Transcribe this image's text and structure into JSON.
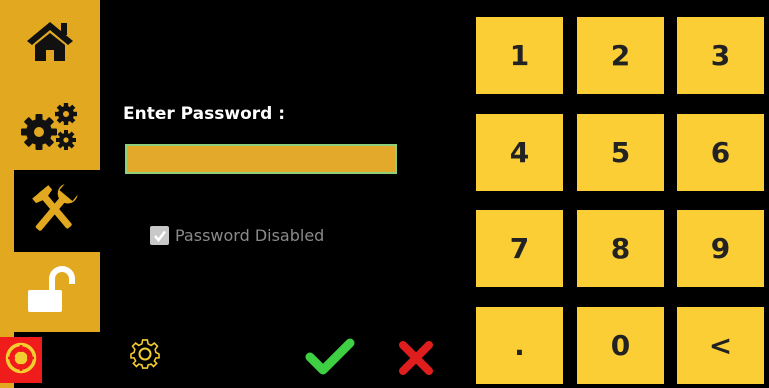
{
  "colors": {
    "accent": "#e2a81f",
    "key_bg": "#fcce35",
    "background": "#000000",
    "input_border": "#8ed07a",
    "ok_green": "#3ecf42",
    "cancel_red": "#e01d1d",
    "alarm_red": "#f01c1c"
  },
  "sidebar": {
    "items": [
      {
        "icon": "home-icon"
      },
      {
        "icon": "gears-icon"
      },
      {
        "icon": "tools-icon"
      },
      {
        "icon": "unlock-icon"
      },
      {
        "icon": "alarm-icon"
      }
    ]
  },
  "password": {
    "label": "Enter Password :",
    "value": "",
    "disabled_label": "Password Disabled",
    "disabled_checked": true
  },
  "footer": {
    "settings_icon": "gear-icon",
    "ok_icon": "check-icon",
    "cancel_icon": "close-icon"
  },
  "keypad": {
    "keys": [
      "1",
      "2",
      "3",
      "4",
      "5",
      "6",
      "7",
      "8",
      "9",
      ".",
      "0",
      "<"
    ]
  }
}
